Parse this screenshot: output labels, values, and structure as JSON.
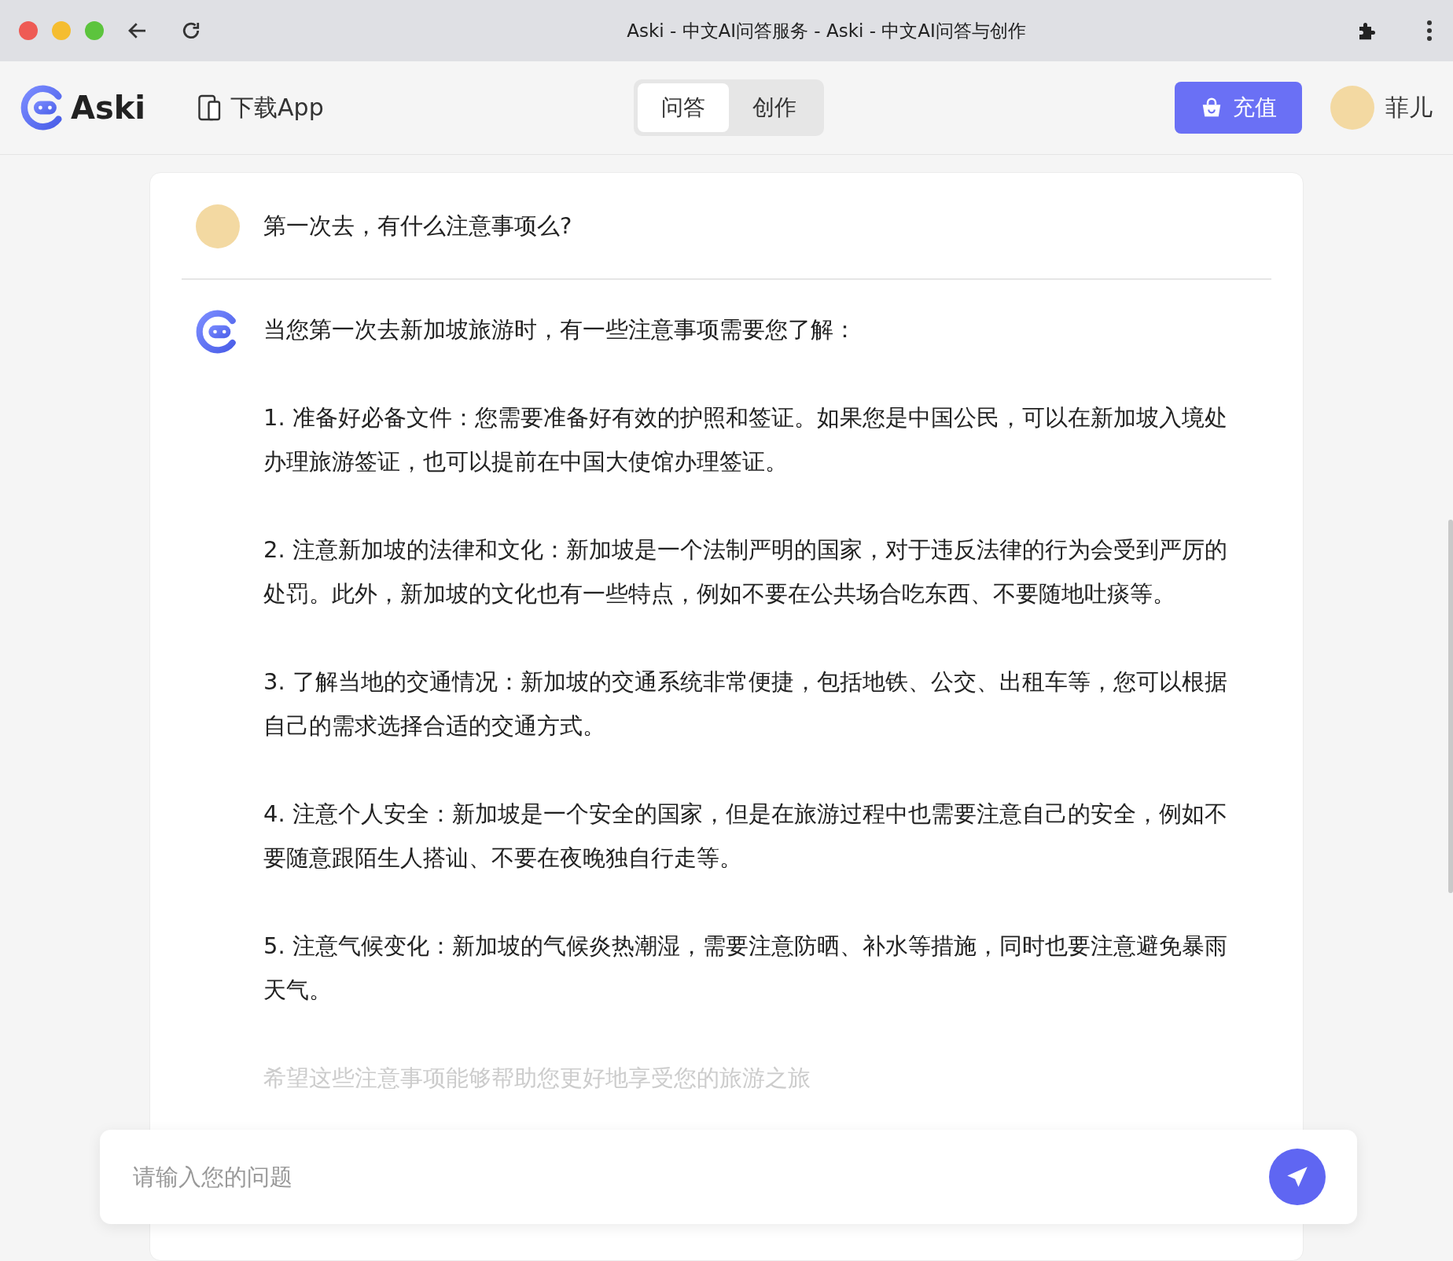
{
  "browser": {
    "title": "Aski - 中文AI问答服务 - Aski - 中文AI问答与创作"
  },
  "header": {
    "logo": "Aski",
    "download": "下载App",
    "tabs": [
      {
        "label": "问答",
        "selected": true
      },
      {
        "label": "创作",
        "selected": false
      }
    ],
    "recharge": "充值",
    "user": "菲儿"
  },
  "question": "第一次去，有什么注意事项么?",
  "answer": {
    "intro": "当您第一次去新加坡旅游时，有一些注意事项需要您了解：",
    "items": [
      "1. 准备好必备文件：您需要准备好有效的护照和签证。如果您是中国公民，可以在新加坡入境处办理旅游签证，也可以提前在中国大使馆办理签证。",
      "2. 注意新加坡的法律和文化：新加坡是一个法制严明的国家，对于违反法律的行为会受到严厉的处罚。此外，新加坡的文化也有一些特点，例如不要在公共场合吃东西、不要随地吐痰等。",
      "3. 了解当地的交通情况：新加坡的交通系统非常便捷，包括地铁、公交、出租车等，您可以根据自己的需求选择合适的交通方式。",
      "4. 注意个人安全：新加坡是一个安全的国家，但是在旅游过程中也需要注意自己的安全，例如不要随意跟陌生人搭讪、不要在夜晚独自行走等。",
      "5. 注意气候变化：新加坡的气候炎热潮湿，需要注意防晒、补水等措施，同时也要注意避免暴雨天气。"
    ],
    "closing": "希望这些注意事项能够帮助您更好地享受您的旅游之旅"
  },
  "input": {
    "placeholder": "请输入您的问题"
  }
}
